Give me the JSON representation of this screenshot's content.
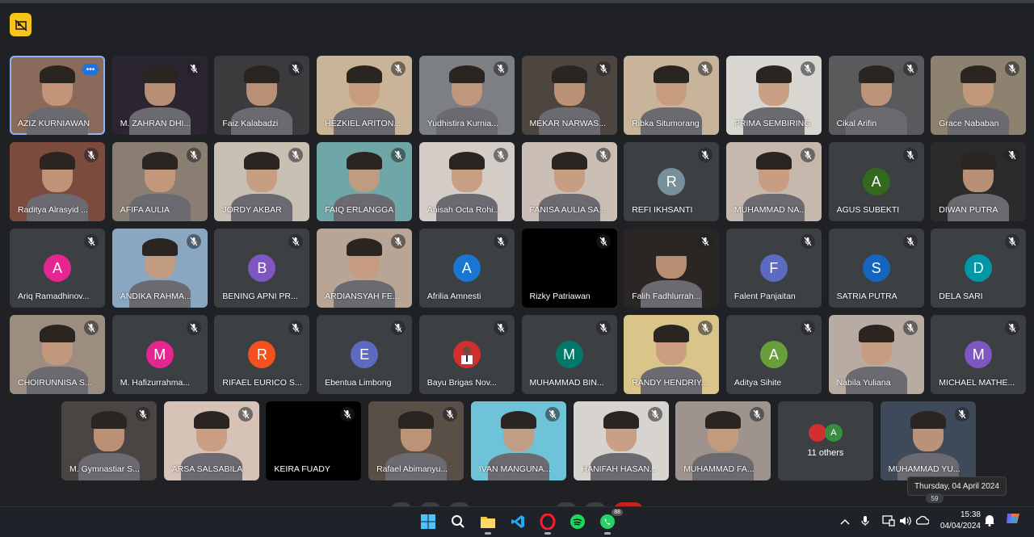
{
  "rows": [
    [
      {
        "name": "AZIZ KURNIAWAN",
        "type": "video",
        "active": true,
        "menu": true,
        "bg": "#8a6a5a"
      },
      {
        "name": "M. ZAHRAN DHI...",
        "type": "video",
        "bg": "#2a2530"
      },
      {
        "name": "Faiz Kalabadzi",
        "type": "video",
        "bg": "#3b3b3e"
      },
      {
        "name": "HEZKIEL ARITON...",
        "type": "video",
        "bg": "#c9b497"
      },
      {
        "name": "Yudhistira Kurnia...",
        "type": "video",
        "bg": "#7c7f84"
      },
      {
        "name": "MEKAR NARWAS...",
        "type": "video",
        "bg": "#4d4540"
      },
      {
        "name": "Ribka Situmorang",
        "type": "video",
        "bg": "#c8b49a"
      },
      {
        "name": "PRIMA SEMBIRING",
        "type": "video",
        "bg": "#d9d6d2"
      },
      {
        "name": "Cikal Arifin",
        "type": "video",
        "bg": "#5a5a5c"
      },
      {
        "name": "Grace Nababan",
        "type": "video",
        "bg": "#8c826f"
      }
    ],
    [
      {
        "name": "Raditya Alrasyid ...",
        "type": "video",
        "bg": "#7d4a3e"
      },
      {
        "name": "AFIFA AULIA",
        "type": "video",
        "bg": "#8a7d72"
      },
      {
        "name": "JORDY AKBAR",
        "type": "video",
        "bg": "#c9c0b4"
      },
      {
        "name": "FAIQ ERLANGGA",
        "type": "video",
        "bg": "#6fa6a8"
      },
      {
        "name": "Anisah Octa Rohi...",
        "type": "video",
        "bg": "#d4cdc7"
      },
      {
        "name": "FANISA AULIA SA...",
        "type": "video",
        "bg": "#cbbfb5"
      },
      {
        "name": "REFI IKHSANTI",
        "type": "avatar",
        "letter": "R",
        "color": "#78909c"
      },
      {
        "name": "MUHAMMAD NA...",
        "type": "video",
        "bg": "#c6b8ad"
      },
      {
        "name": "AGUS SUBEKTI",
        "type": "avatar",
        "letter": "A",
        "color": "#33691e"
      },
      {
        "name": "DIWAN PUTRA",
        "type": "video",
        "bg": "#2b2b2c"
      }
    ],
    [
      {
        "name": "Ariq Ramadhinov...",
        "type": "avatar",
        "letter": "A",
        "color": "#e52592"
      },
      {
        "name": "ANDIKA RAHMA...",
        "type": "video",
        "bg": "#8aa7c2"
      },
      {
        "name": "BENING APNI PR...",
        "type": "avatar",
        "letter": "B",
        "color": "#7e57c2"
      },
      {
        "name": "ARDIANSYAH FE...",
        "type": "video",
        "bg": "#b9a596"
      },
      {
        "name": "Afrilia Amnesti",
        "type": "avatar",
        "letter": "A",
        "color": "#1976d2"
      },
      {
        "name": "Rizky Patriawan",
        "type": "video",
        "bg": "#000000"
      },
      {
        "name": "Falih Fadhlurrah...",
        "type": "video",
        "bg": "#2a2624"
      },
      {
        "name": "Falent Panjaitan",
        "type": "avatar",
        "letter": "F",
        "color": "#5c6bc0"
      },
      {
        "name": "SATRIA PUTRA",
        "type": "avatar",
        "letter": "S",
        "color": "#1565c0"
      },
      {
        "name": "DELA SARI",
        "type": "avatar",
        "letter": "D",
        "color": "#0097a7"
      }
    ],
    [
      {
        "name": "CHOIRUNNISA S...",
        "type": "video",
        "bg": "#9b8d80"
      },
      {
        "name": "M. Hafizurrahma...",
        "type": "avatar",
        "letter": "M",
        "color": "#e52592"
      },
      {
        "name": "RIFAEL EURICO S...",
        "type": "avatar",
        "letter": "R",
        "color": "#f4511e"
      },
      {
        "name": "Ebentua Limbong",
        "type": "avatar",
        "letter": "E",
        "color": "#5c6bc0"
      },
      {
        "name": "Bayu Brigas Nov...",
        "type": "photo",
        "color": "#d32f2f"
      },
      {
        "name": "MUHAMMAD BIN...",
        "type": "avatar",
        "letter": "M",
        "color": "#00796b"
      },
      {
        "name": "RANDY HENDRIY...",
        "type": "video",
        "bg": "#d9c48a"
      },
      {
        "name": "Aditya Sihite",
        "type": "avatar",
        "letter": "A",
        "color": "#689f38"
      },
      {
        "name": "Nabila Yuliana",
        "type": "video",
        "bg": "#b8aba2"
      },
      {
        "name": "MICHAEL MATHE...",
        "type": "avatar",
        "letter": "M",
        "color": "#7e57c2"
      }
    ],
    [
      {
        "name": "M. Gymnastiar S...",
        "type": "video",
        "bg": "#4a4442"
      },
      {
        "name": "ARSA SALSABILA",
        "type": "video",
        "bg": "#d7c2b8"
      },
      {
        "name": "KEIRA FUADY",
        "type": "video",
        "bg": "#000000"
      },
      {
        "name": "Rafael Abimanyu...",
        "type": "video",
        "bg": "#5a4f47"
      },
      {
        "name": "IVAN MANGUNA...",
        "type": "video",
        "bg": "#6ec3d8"
      },
      {
        "name": "HANIFAH HASAN...",
        "type": "video",
        "bg": "#d7d3cf"
      },
      {
        "name": "MUHAMMAD FA...",
        "type": "video",
        "bg": "#9e948d"
      },
      {
        "name": "11 others",
        "type": "others"
      },
      {
        "name": "MUHAMMAD YU...",
        "type": "video",
        "bg": "#3e4a5a"
      }
    ]
  ],
  "others_letter": "A",
  "tooltip": "Thursday, 04 April 2024",
  "badge_count": "59",
  "whatsapp_badge": "88",
  "clock": {
    "time": "15:38",
    "date": "04/04/2024"
  }
}
